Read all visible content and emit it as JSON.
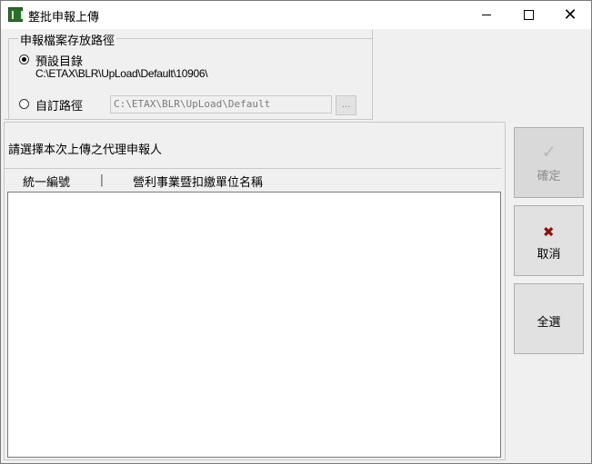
{
  "window": {
    "title": "整批申報上傳",
    "controls": {
      "minimize_icon": "minimize-icon",
      "maximize_icon": "maximize-icon",
      "close_icon": "close-icon"
    }
  },
  "path_group": {
    "legend": "申報檔案存放路徑",
    "default_option": {
      "label": "預設目錄",
      "path": "C:\\ETAX\\BLR\\UpLoad\\Default\\10906\\",
      "checked": true
    },
    "custom_option": {
      "label": "自訂路徑",
      "value": "C:\\ETAX\\BLR\\UpLoad\\Default",
      "checked": false
    },
    "browse_label": "..."
  },
  "list": {
    "caption": "請選擇本次上傳之代理申報人",
    "columns": [
      "統一編號",
      "營利事業暨扣繳單位名稱"
    ],
    "column_divider": "|",
    "rows": []
  },
  "buttons": {
    "confirm": {
      "label": "確定",
      "icon": "check-icon",
      "enabled": false
    },
    "cancel": {
      "label": "取消",
      "icon": "x-icon",
      "icon_color": "#8b1010"
    },
    "select_all": {
      "label": "全選"
    }
  }
}
